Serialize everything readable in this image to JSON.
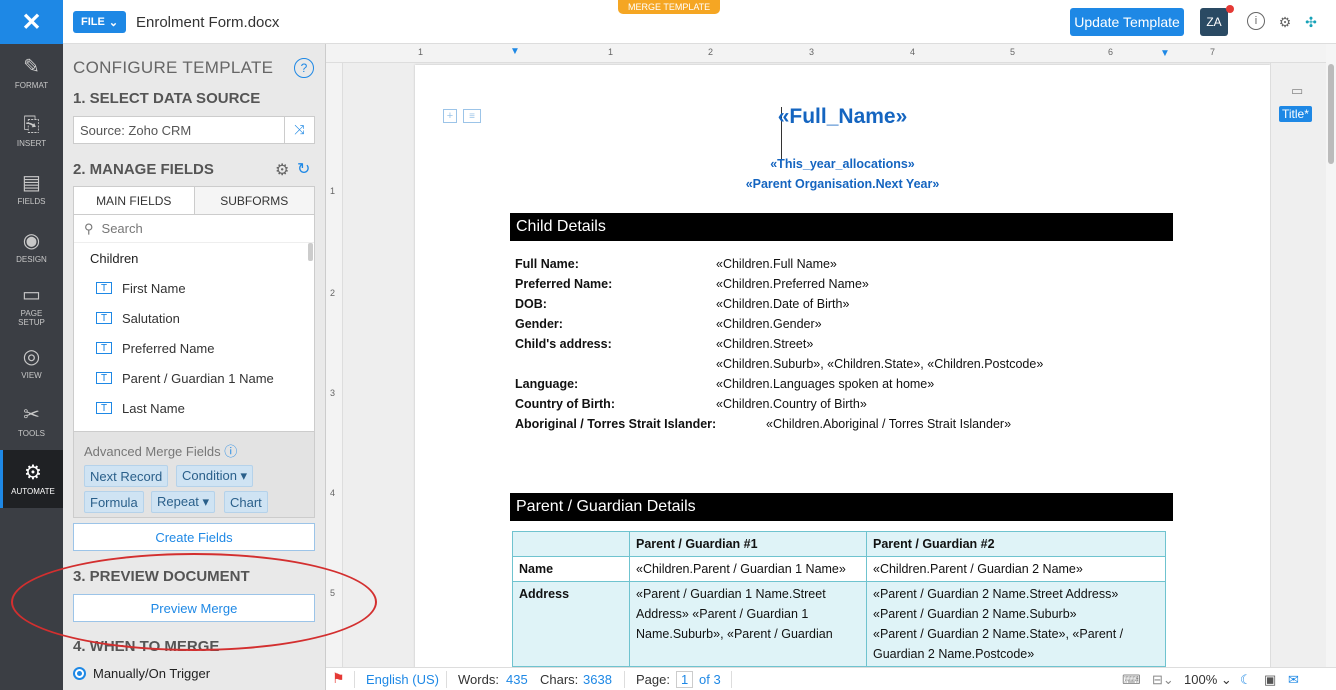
{
  "rail": {
    "close": "✕",
    "items": [
      {
        "label": "FORMAT",
        "icon": "format-icon",
        "glyph": "✎"
      },
      {
        "label": "INSERT",
        "icon": "insert-icon",
        "glyph": "⎘"
      },
      {
        "label": "FIELDS",
        "icon": "fields-icon",
        "glyph": "▤"
      },
      {
        "label": "DESIGN",
        "icon": "palette-icon",
        "glyph": "◉"
      },
      {
        "label": "PAGE SETUP",
        "icon": "page-setup-icon",
        "glyph": "▭"
      },
      {
        "label": "VIEW",
        "icon": "eye-icon",
        "glyph": "◎"
      },
      {
        "label": "TOOLS",
        "icon": "tools-icon",
        "glyph": "✂"
      },
      {
        "label": "AUTOMATE",
        "icon": "automate-icon",
        "glyph": "⚙"
      }
    ]
  },
  "topbar": {
    "file_label": "FILE",
    "doc_name": "Enrolment Form.docx",
    "merge_tag": "MERGE TEMPLATE",
    "update_label": "Update Template",
    "translate_label": "ZA"
  },
  "panel": {
    "title": "CONFIGURE TEMPLATE",
    "help": "?",
    "step1": "1. SELECT DATA SOURCE",
    "source": "Source: Zoho CRM",
    "step2": "2. MANAGE FIELDS",
    "tab_main": "MAIN FIELDS",
    "tab_sub": "SUBFORMS",
    "search_placeholder": "Search",
    "group": "Children",
    "fields": [
      "First Name",
      "Salutation",
      "Preferred Name",
      "Parent / Guardian 1 Name",
      "Last Name"
    ],
    "adv_title": "Advanced Merge Fields",
    "chips": [
      "Next Record",
      "Condition ▾",
      "Formula",
      "Repeat ▾",
      "Chart"
    ],
    "create_fields": "Create Fields",
    "step3": "3. PREVIEW DOCUMENT",
    "preview_merge": "Preview Merge",
    "step4": "4. WHEN TO MERGE",
    "radio_label": "Manually/On Trigger"
  },
  "ruler": {
    "h": [
      "1",
      "1",
      "2",
      "3",
      "4",
      "5",
      "6",
      "7"
    ],
    "v": [
      "1",
      "2",
      "3",
      "4",
      "5"
    ]
  },
  "doc": {
    "full_name": "«Full_Name»",
    "alloc": "«This_year_allocations»",
    "parent_org": "«Parent Organisation.Next Year»",
    "child_header": "Child Details",
    "child_rows": [
      {
        "label": "Full Name:",
        "value": "«Children.Full Name»"
      },
      {
        "label": "Preferred Name:",
        "value": "«Children.Preferred Name»"
      },
      {
        "label": "DOB:",
        "value": "«Children.Date of Birth»"
      },
      {
        "label": "Gender:",
        "value": "«Children.Gender»"
      },
      {
        "label": "Child's address:",
        "value": "«Children.Street»"
      },
      {
        "label": "",
        "value": "«Children.Suburb», «Children.State», «Children.Postcode»"
      },
      {
        "label": "Language:",
        "value": "«Children.Languages spoken at home»"
      },
      {
        "label": "Country of Birth:",
        "value": "«Children.Country of Birth»"
      },
      {
        "label": "Aboriginal / Torres Strait Islander:",
        "value": "«Children.Aboriginal / Torres Strait Islander»"
      }
    ],
    "parent_header": "Parent / Guardian Details",
    "table_head": [
      "",
      "Parent / Guardian #1",
      "Parent / Guardian #2"
    ],
    "name_label": "Name",
    "name_p1": "«Children.Parent / Guardian 1 Name»",
    "name_p2": "«Children.Parent / Guardian 2 Name»",
    "addr_label": "Address",
    "addr_p1": "«Parent / Guardian 1 Name.Street Address» «Parent / Guardian 1 Name.Suburb», «Parent / Guardian",
    "addr_p2_1": "«Parent / Guardian 2 Name.Street Address»",
    "addr_p2_2": "«Parent / Guardian 2 Name.Suburb»",
    "addr_p2_3": "«Parent / Guardian 2 Name.State», «Parent / Guardian 2 Name.Postcode»"
  },
  "rightpane": {
    "title_chip": "Title*"
  },
  "status": {
    "lang": "English (US)",
    "words_label": "Words:",
    "words": "435",
    "chars_label": "Chars:",
    "chars": "3638",
    "page_label": "Page:",
    "page": "1",
    "of": "of 3",
    "zoom": "100%"
  }
}
